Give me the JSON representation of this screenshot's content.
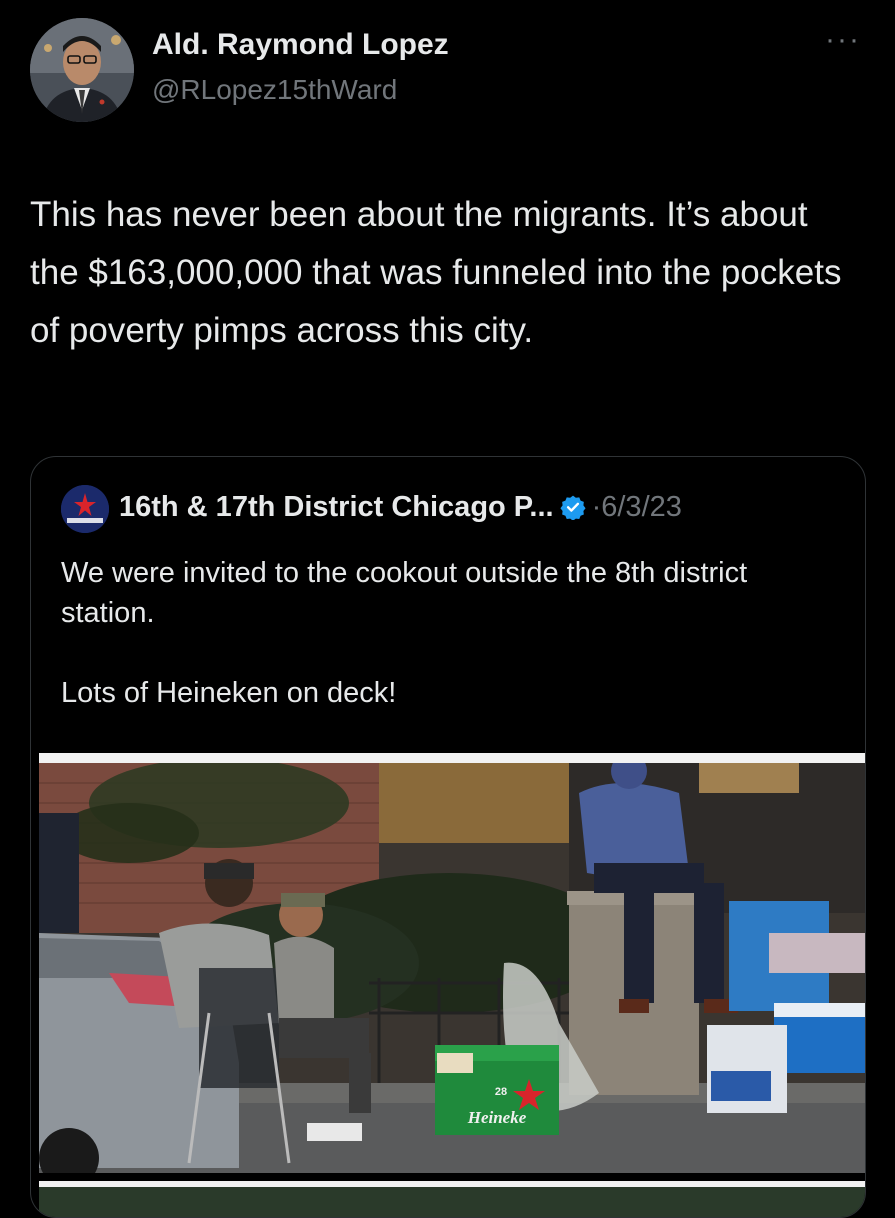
{
  "author": {
    "name": "Ald. Raymond Lopez",
    "handle": "@RLopez15thWard"
  },
  "more_icon": "more-dots-icon",
  "tweet_text": "This has never been about the migrants. It’s about the $163,000,000 that was funneled into the pockets of poverty pimps across this city.",
  "quote": {
    "name": "16th & 17th District Chicago P...",
    "separator": "·",
    "date": "6/3/23",
    "verified_icon": "verified-badge-icon",
    "text_line1": "We were invited to the cookout outside the 8th district station.",
    "text_line2": "Lots of Heineken on deck!",
    "photo_label": "Heineke",
    "photo_sublabel": "28"
  },
  "colors": {
    "background": "#000000",
    "text": "#e7e9ea",
    "muted": "#71767b",
    "border": "#2f3336",
    "verified": "#1d9bf0"
  }
}
